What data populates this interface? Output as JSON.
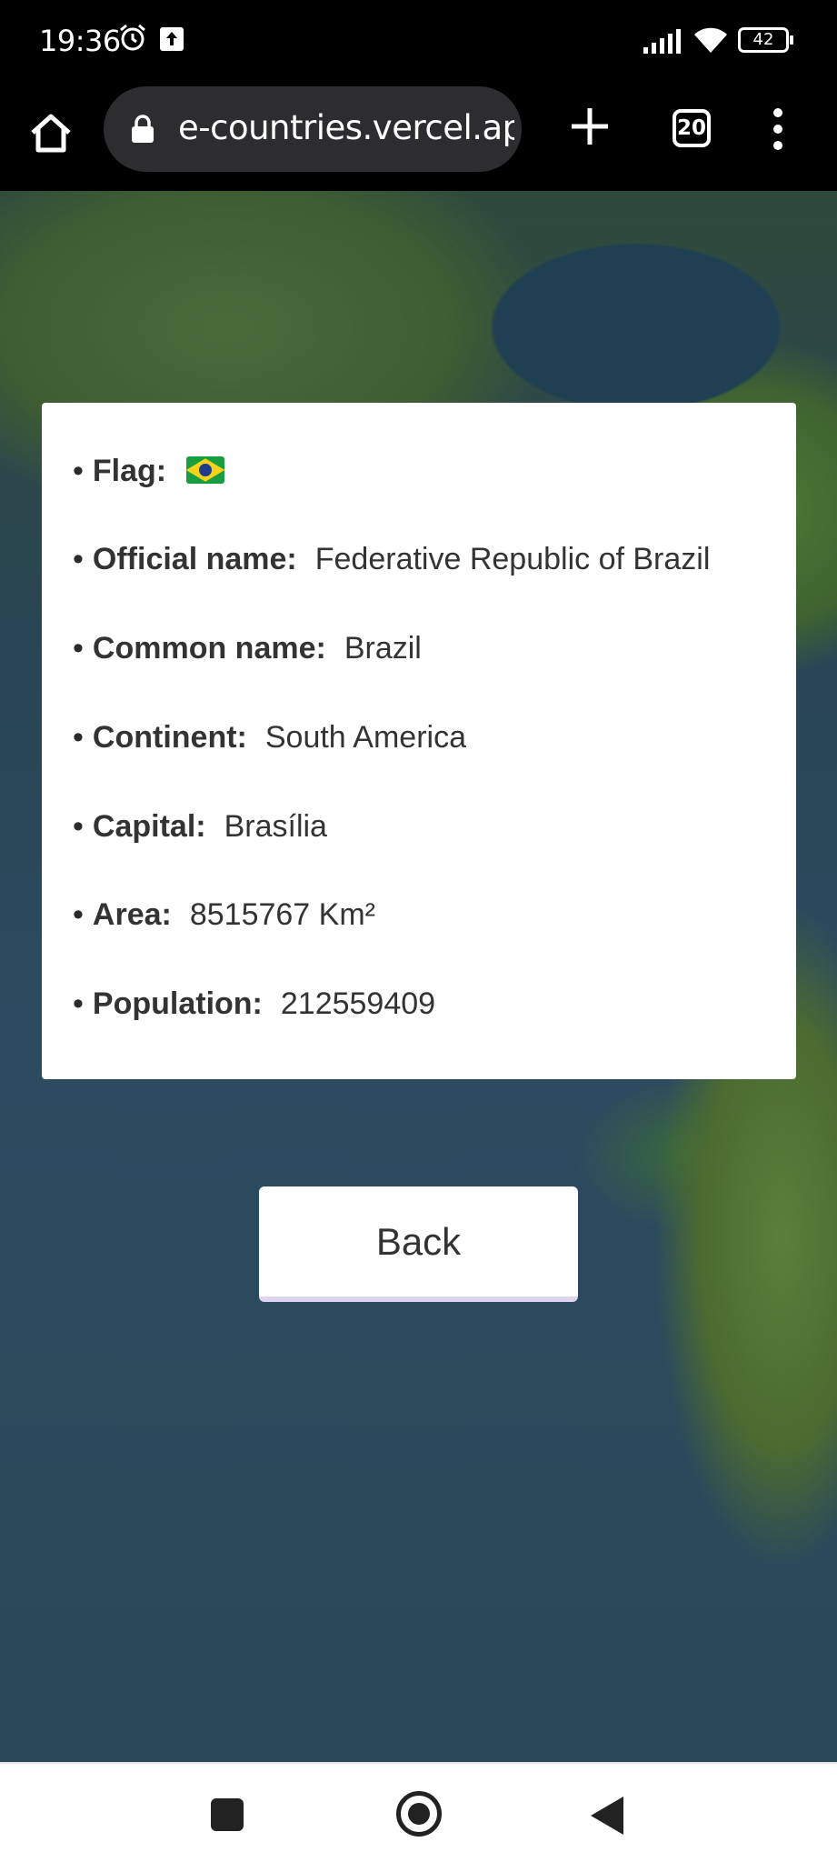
{
  "status_bar": {
    "time": "19:36",
    "battery": "42",
    "icons": [
      "alarm-icon",
      "upload-icon",
      "signal-icon",
      "wifi-icon",
      "battery-icon"
    ]
  },
  "browser": {
    "url": "e-countries.vercel.app",
    "tab_count": "20",
    "icons": [
      "home-icon",
      "lock-icon",
      "plus-icon",
      "tabs-icon",
      "menu-icon"
    ]
  },
  "country": {
    "rows": [
      {
        "label": "Flag:",
        "value": ""
      },
      {
        "label": "Official name:",
        "value": "Federative Republic of Brazil"
      },
      {
        "label": "Common name:",
        "value": "Brazil"
      },
      {
        "label": "Continent:",
        "value": "South America"
      },
      {
        "label": "Capital:",
        "value": "Brasília"
      },
      {
        "label": "Area:",
        "value": "8515767 Km²"
      },
      {
        "label": "Population:",
        "value": "212559409"
      }
    ],
    "flag_icon": "brazil-flag-icon"
  },
  "actions": {
    "back_label": "Back"
  },
  "nav_bar": {
    "icons": [
      "recents-icon",
      "home-circle-icon",
      "back-triangle-icon"
    ]
  },
  "colors": {
    "card_bg": "#ffffff",
    "button_border": "#ddd5ee",
    "toolbar_bg": "#000000",
    "url_pill_bg": "#2d2d2f"
  }
}
